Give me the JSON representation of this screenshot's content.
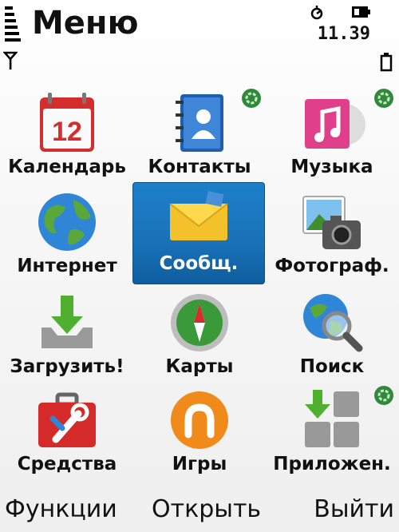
{
  "status": {
    "title": "Меню",
    "time": "11.39"
  },
  "menu": {
    "items": [
      {
        "label": "Календарь",
        "icon": "calendar-icon",
        "day": "12",
        "badge": false
      },
      {
        "label": "Контакты",
        "icon": "contacts-icon",
        "badge": true
      },
      {
        "label": "Музыка",
        "icon": "music-icon",
        "badge": true
      },
      {
        "label": "Интернет",
        "icon": "globe-icon",
        "badge": false
      },
      {
        "label": "Сообщ.",
        "icon": "envelope-icon",
        "badge": false,
        "selected": true
      },
      {
        "label": "Фотограф.",
        "icon": "photo-camera-icon",
        "badge": false
      },
      {
        "label": "Загрузить!",
        "icon": "download-icon",
        "badge": false
      },
      {
        "label": "Карты",
        "icon": "compass-icon",
        "badge": false
      },
      {
        "label": "Поиск",
        "icon": "search-icon",
        "badge": false
      },
      {
        "label": "Средства",
        "icon": "toolbox-icon",
        "badge": false
      },
      {
        "label": "Игры",
        "icon": "games-icon",
        "badge": false
      },
      {
        "label": "Приложен.",
        "icon": "apps-icon",
        "badge": true
      }
    ]
  },
  "softkeys": {
    "left": "Функции",
    "middle": "Открыть",
    "right": "Выйти"
  },
  "colors": {
    "selection": "#1a73b9",
    "badge": "#2d8a3a"
  }
}
